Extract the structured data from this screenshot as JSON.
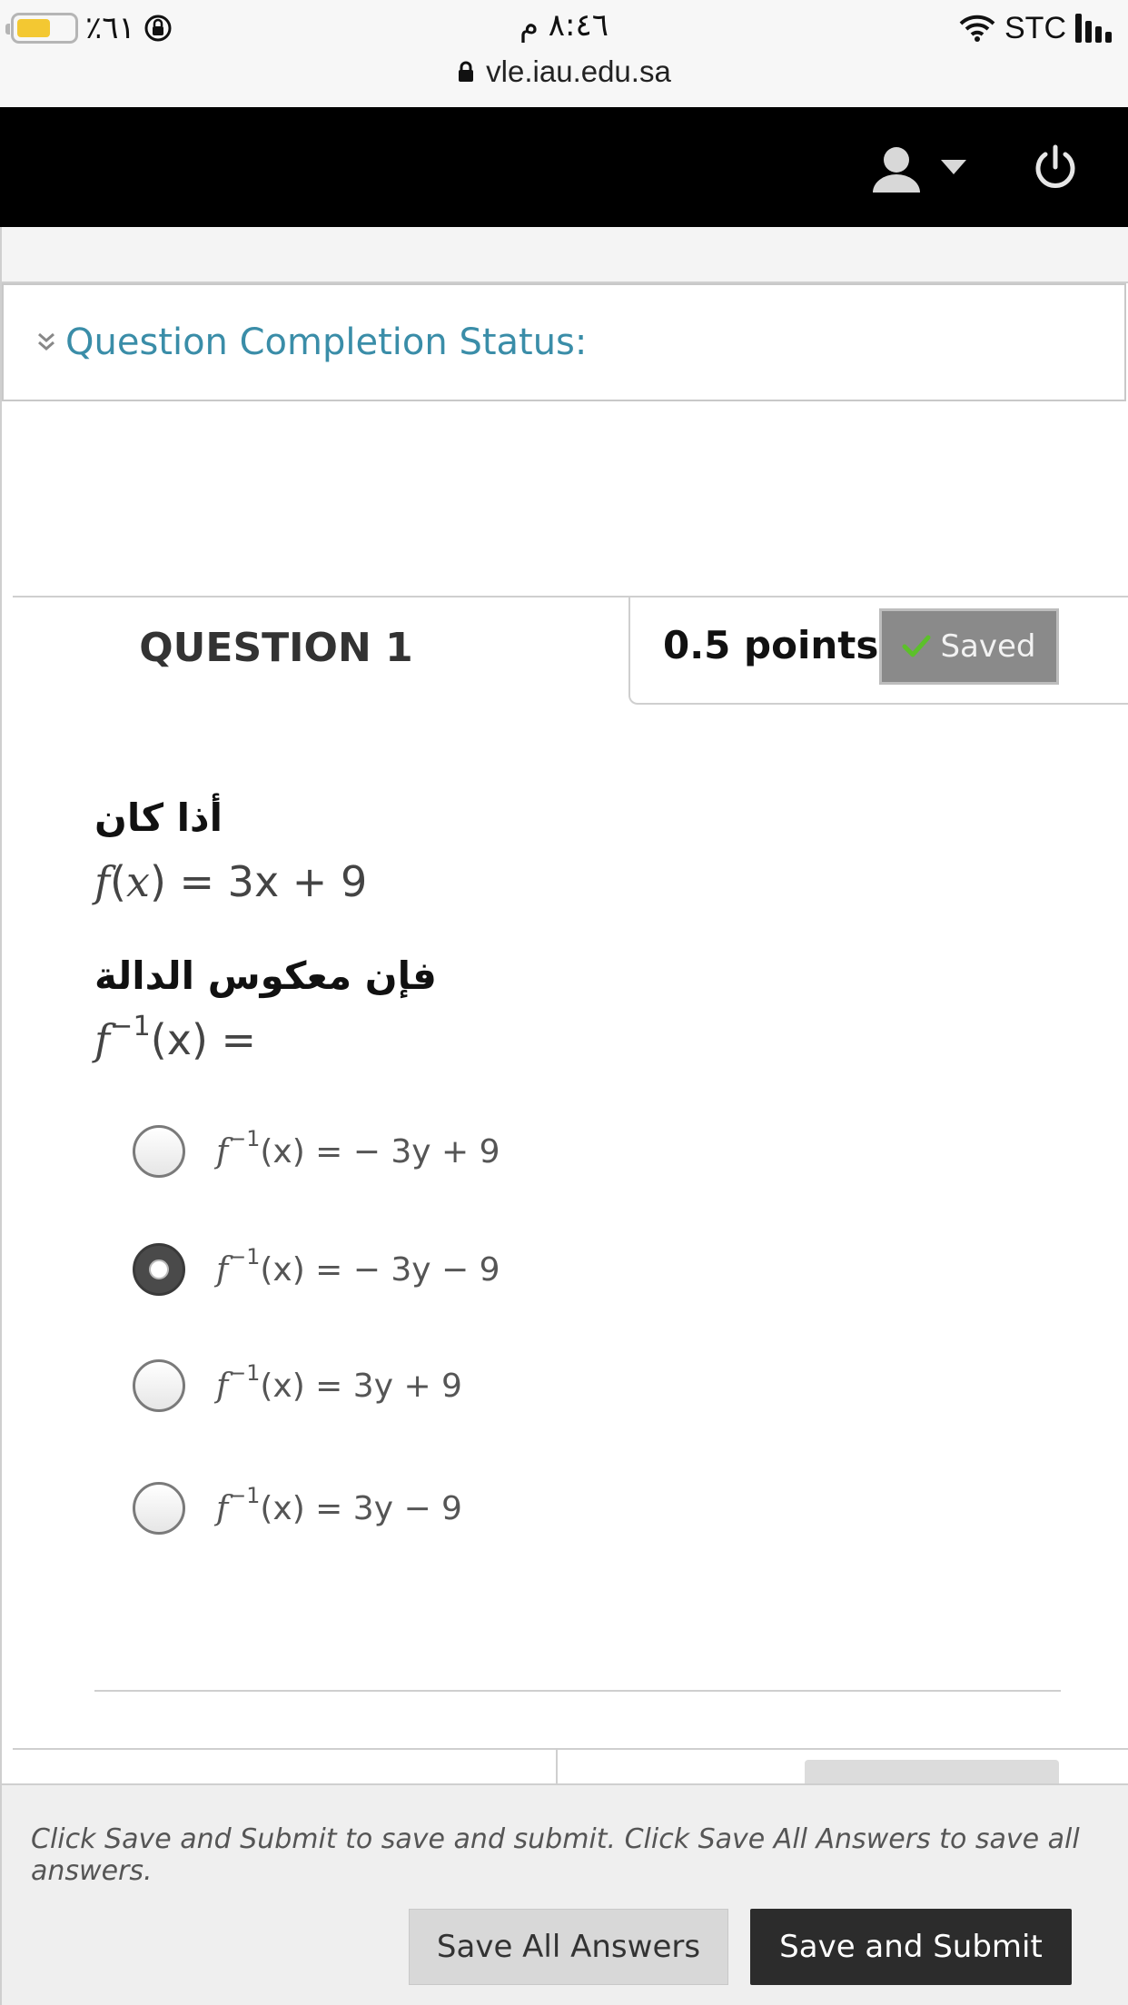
{
  "status_bar": {
    "battery_text": "٪٦١",
    "battery_level": 0.61,
    "time": "٨:٤٦ م",
    "carrier": "STC",
    "url": "vle.iau.edu.sa"
  },
  "nav": {
    "user_icon": "user-icon",
    "power_icon": "power-icon"
  },
  "completion": {
    "label": "Question Completion Status:"
  },
  "question": {
    "title": "QUESTION 1",
    "points": "0.5 points",
    "saved_label": "Saved",
    "prompt_ar_1": "أذا كان",
    "given_rhs": "= 3x + 9",
    "prompt_ar_2": "فإن معكوس الدالة",
    "ask_rhs": "(x) =",
    "options": [
      {
        "rhs": "(x) = − 3y + 9",
        "selected": false
      },
      {
        "rhs": "(x) = − 3y − 9",
        "selected": true
      },
      {
        "rhs": "(x) = 3y + 9",
        "selected": false
      },
      {
        "rhs": "(x) = 3y − 9",
        "selected": false
      }
    ]
  },
  "footer": {
    "note": "Click Save and Submit to save and submit. Click Save All Answers to save all answers.",
    "save_all_label": "Save All Answers",
    "save_submit_label": "Save and Submit"
  },
  "colors": {
    "accent_link": "#3a8da8",
    "nav_bg": "#000000",
    "saved_bg": "#8a8a8a",
    "submit_bg": "#2c2c2c"
  }
}
